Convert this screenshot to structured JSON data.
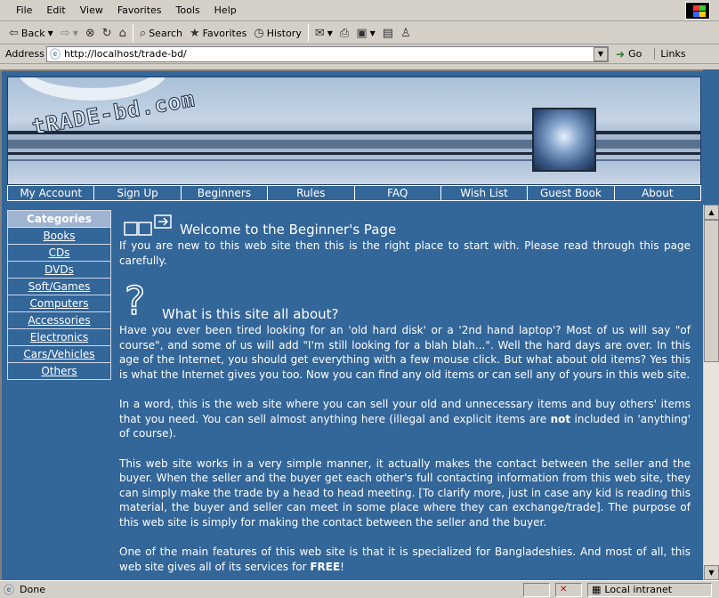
{
  "menu": [
    "File",
    "Edit",
    "View",
    "Favorites",
    "Tools",
    "Help"
  ],
  "toolbar": {
    "back": "Back",
    "search": "Search",
    "favorites": "Favorites",
    "history": "History"
  },
  "address": {
    "label": "Address",
    "url": "http://localhost/trade-bd/",
    "go": "Go",
    "links": "Links"
  },
  "banner": {
    "logo": "tRADE-bd.com"
  },
  "nav": [
    "My Account",
    "Sign Up",
    "Beginners",
    "Rules",
    "FAQ",
    "Wish List",
    "Guest Book",
    "About"
  ],
  "categories": {
    "title": "Categories",
    "items": [
      "Books",
      "CDs",
      "DVDs",
      "Soft/Games",
      "Computers",
      "Accessories",
      "Electronics",
      "Cars/Vehicles",
      "Others"
    ]
  },
  "content": {
    "heading1": "Welcome to the Beginner's Page",
    "intro": "If you are new to this web site then this is the right place to start with. Please read through this page carefully.",
    "heading2": "What is this site all about?",
    "para1": "Have you ever been tired looking for an 'old hard disk' or a '2nd hand laptop'? Most of us will say \"of course\", and some of us will add \"I'm still looking for a blah blah...\". Well the hard days are over. In this age of the Internet, you should get everything with a few mouse click. But what about old items? Yes this is what the Internet gives you too. Now you can find any old items or can sell any of yours in this web site.",
    "para2a": "In a word, this is the web site where you can sell your old and unnecessary items and buy others' items that you need. You can sell almost anything here (illegal and explicit items are ",
    "para2b": "not",
    "para2c": " included in 'anything' of course).",
    "para3": "This web site works in a very simple manner, it actually makes the contact between the seller and the buyer. When the seller and the buyer get each other's full contacting information from this web site, they can simply make the trade by a head to head meeting. [To clarify more, just in case any kid is reading this material, the buyer and seller can meet in some place where they can exchange/trade]. The purpose of this web site is simply for making the contact between the seller and the buyer.",
    "para4a": "One of the main features of this web site is that it is specialized for Bangladeshies. And most of all, this web site gives all of its services for ",
    "para4b": "FREE",
    "para4c": "!"
  },
  "status": {
    "left": "Done",
    "zone": "Local intranet"
  }
}
